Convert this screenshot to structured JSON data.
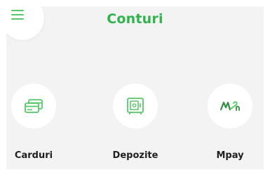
{
  "header": {
    "title": "Conturi",
    "menu_icon": "hamburger-menu-icon"
  },
  "accounts": {
    "items": [
      {
        "label": "Carduri",
        "icon": "credit-cards-icon"
      },
      {
        "label": "Depozite",
        "icon": "safe-icon"
      },
      {
        "label": "Mpay",
        "icon": "mpay-logo-icon"
      }
    ]
  },
  "colors": {
    "accent": "#2fb44c",
    "icon_green": "#56c86a",
    "panel_background": "#f3f3f3",
    "tile_background": "#ffffff",
    "label_text": "#1f1f1f"
  }
}
